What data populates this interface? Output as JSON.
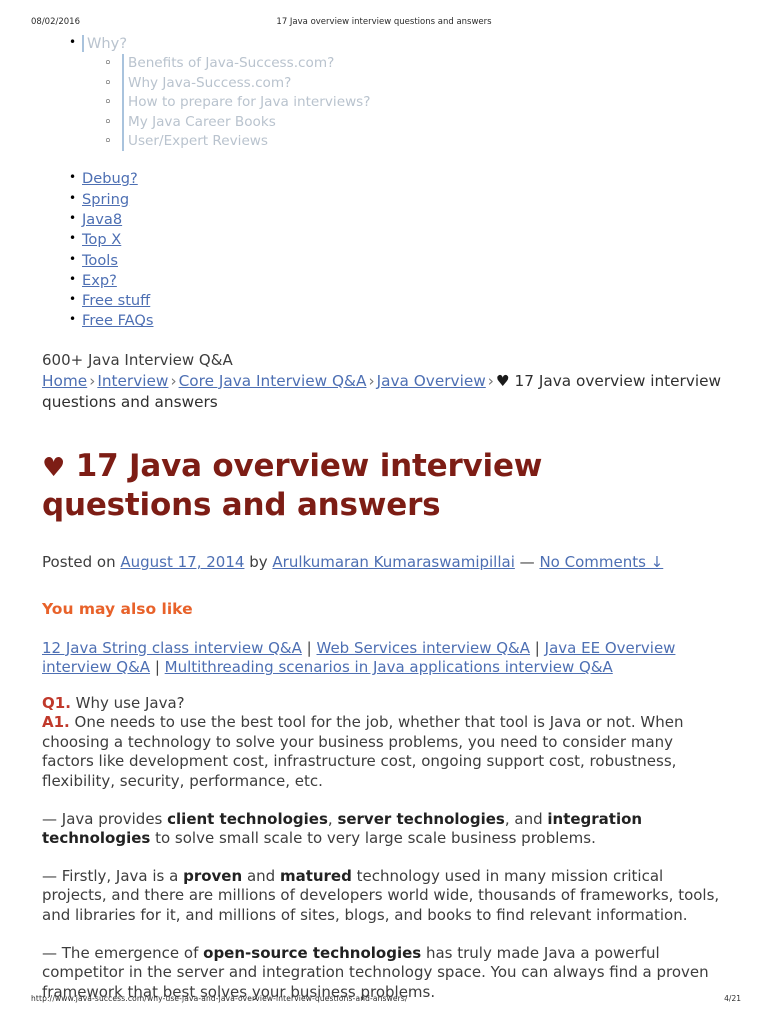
{
  "print_header": {
    "date": "08/02/2016",
    "title": "17 Java overview interview questions and answers"
  },
  "print_footer": {
    "url": "http://www.java-success.com/why-use-java-and-java-overview-interview-questions-and-answers/",
    "page": "4/21"
  },
  "nav": {
    "why_label": "Why?",
    "submenu": [
      "Benefits of Java-Success.com?",
      "Why Java-Success.com?",
      "How to prepare for Java interviews?",
      "My Java Career Books",
      "User/Expert Reviews"
    ],
    "links": [
      "Debug?",
      "Spring",
      "Java8",
      "Top X",
      "Tools",
      "Exp?",
      "Free stuff",
      "Free FAQs"
    ]
  },
  "tagline": "600+ Java Interview Q&A",
  "breadcrumb": {
    "items": [
      "Home",
      "Interview",
      "Core Java Interview Q&A",
      "Java Overview"
    ],
    "separator": "›",
    "heart": "♥",
    "current": "17 Java overview interview questions and answers"
  },
  "post": {
    "heart": "♥",
    "title": "17 Java overview interview questions and answers",
    "posted_on_label": "Posted on",
    "date": "August 17, 2014",
    "by_label": "by",
    "author": "Arulkumaran Kumaraswamipillai",
    "dash": "—",
    "comments": "No Comments ↓"
  },
  "also_like": {
    "heading": "You may also like",
    "links": [
      "12 Java String class interview Q&A",
      "Web Services interview Q&A",
      "Java EE Overview interview Q&A",
      "Multithreading scenarios in Java applications interview Q&A"
    ],
    "separator": "|"
  },
  "qa": {
    "q_label": "Q1.",
    "q_text": "Why use Java?",
    "a_label": "A1.",
    "a_text": "One needs to use the best tool for the job, whether that tool is Java or not. When choosing a technology to solve your business problems, you need to consider many factors like development cost, infrastructure cost, ongoing support cost, robustness, flexibility, security, performance, etc."
  },
  "paragraphs": [
    {
      "p1": "— Java provides ",
      "b1": "client technologies",
      "p2": ", ",
      "b2": "server technologies",
      "p3": ", and ",
      "b3": "integration technologies",
      "p4": " to solve small scale to very large scale business problems."
    },
    {
      "p1": "— Firstly, Java is a ",
      "b1": "proven",
      "p2": " and ",
      "b2": "matured",
      "p3": " technology used in many mission critical projects, and there are millions of developers world wide, thousands of frameworks, tools, and libraries for it, and millions of sites, blogs, and books to find relevant information."
    },
    {
      "p1": "— The emergence of ",
      "b1": "open-source technologies",
      "p2": " has truly made Java a powerful competitor in the server and integration technology space. You can always find a proven framework that best solves your business problems."
    }
  ]
}
